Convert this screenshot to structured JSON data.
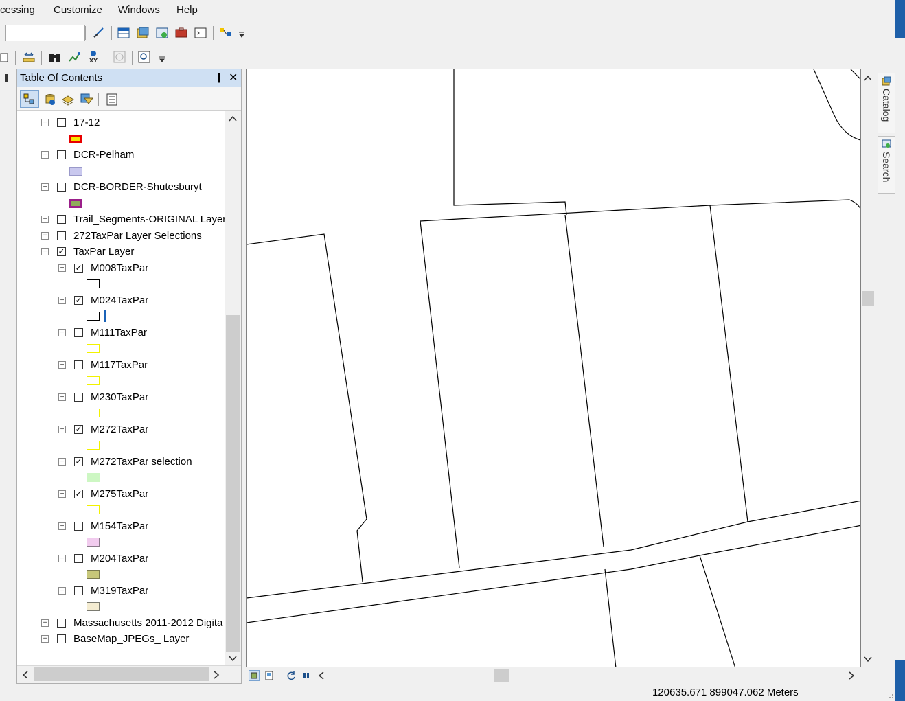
{
  "menu": {
    "items": [
      "cessing",
      "Customize",
      "Windows",
      "Help"
    ]
  },
  "toc": {
    "title": "Table Of Contents",
    "pin_label": "❙",
    "close_label": "✕",
    "layers": [
      {
        "label": "17-12",
        "checked": false,
        "expanded": true,
        "level": 0,
        "swatch": {
          "fill": "#f6e600",
          "border": "#e80000"
        }
      },
      {
        "label": "DCR-Pelham",
        "checked": false,
        "expanded": true,
        "level": 0,
        "swatch": {
          "fill": "#c9c8ee",
          "border": "#9a99c9"
        }
      },
      {
        "label": "DCR-BORDER-Shutesburyt",
        "checked": false,
        "expanded": true,
        "level": 0,
        "swatch": {
          "fill": "#8fad5a",
          "border": "#9b1f8a"
        }
      },
      {
        "label": "Trail_Segments-ORIGINAL Layer",
        "checked": false,
        "expanded": false,
        "level": 0
      },
      {
        "label": "272TaxPar Layer Selections",
        "checked": false,
        "expanded": false,
        "level": 0
      },
      {
        "label": "TaxPar Layer",
        "checked": true,
        "expanded": true,
        "level": 0
      },
      {
        "label": "M008TaxPar",
        "checked": true,
        "expanded": true,
        "level": 1,
        "swatch": {
          "fill": "#ffffff",
          "border": "#000000"
        }
      },
      {
        "label": "M024TaxPar",
        "checked": true,
        "expanded": true,
        "level": 1,
        "swatch": {
          "fill": "#ffffff",
          "border": "#000000"
        }
      },
      {
        "label": "M111TaxPar",
        "checked": false,
        "expanded": true,
        "level": 1,
        "swatch": {
          "fill": "#ffffff",
          "border": "#f2f200"
        }
      },
      {
        "label": "M117TaxPar",
        "checked": false,
        "expanded": true,
        "level": 1,
        "swatch": {
          "fill": "#ffffff",
          "border": "#f2f200"
        }
      },
      {
        "label": "M230TaxPar",
        "checked": false,
        "expanded": true,
        "level": 1,
        "swatch": {
          "fill": "#ffffff",
          "border": "#f2f200"
        }
      },
      {
        "label": "M272TaxPar",
        "checked": true,
        "expanded": true,
        "level": 1,
        "swatch": {
          "fill": "#ffffff",
          "border": "#f2f200"
        }
      },
      {
        "label": "M272TaxPar selection",
        "checked": true,
        "expanded": true,
        "level": 1,
        "swatch": {
          "fill": "#cdf7c3",
          "border": "#cdf7c3"
        }
      },
      {
        "label": "M275TaxPar",
        "checked": true,
        "expanded": true,
        "level": 1,
        "swatch": {
          "fill": "#ffffff",
          "border": "#f2f200"
        }
      },
      {
        "label": "M154TaxPar",
        "checked": false,
        "expanded": true,
        "level": 1,
        "swatch": {
          "fill": "#f1cbee",
          "border": "#8a7a8a"
        }
      },
      {
        "label": "M204TaxPar",
        "checked": false,
        "expanded": true,
        "level": 1,
        "swatch": {
          "fill": "#c7c77a",
          "border": "#7a7a50"
        }
      },
      {
        "label": "M319TaxPar",
        "checked": false,
        "expanded": true,
        "level": 1,
        "swatch": {
          "fill": "#f4ecd1",
          "border": "#7a7a70"
        }
      },
      {
        "label": "Massachusetts 2011-2012 Digita",
        "checked": false,
        "expanded": false,
        "level": 0
      },
      {
        "label": "BaseMap_JPEGs_ Layer",
        "checked": false,
        "expanded": false,
        "level": 0
      }
    ]
  },
  "dock": {
    "catalog_label": "Catalog",
    "search_label": "Search"
  },
  "status": {
    "coordinates": "120635.671  899047.062 Meters"
  }
}
